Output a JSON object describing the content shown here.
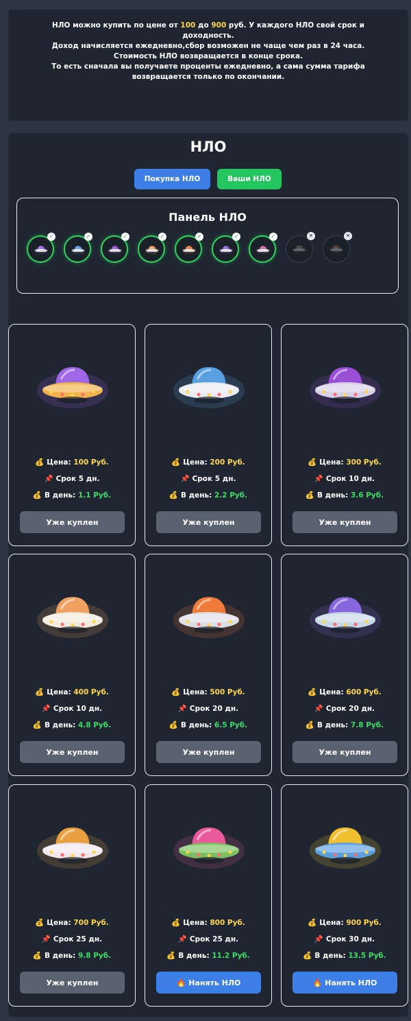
{
  "info": {
    "line1_pre": "НЛО можно купить по цене от ",
    "line1_min": "100",
    "line1_mid": " до ",
    "line1_max": "900",
    "line1_post": " руб. У каждого НЛО свой срок и",
    "line2": "доходность.",
    "line3": "Доход начисляется ежедневно,сбор возможен не чаще чем раз в 24 часа.",
    "line4": "Стоимость НЛО возвращается в конце срока.",
    "line5": "То есть сначала вы получаете проценты ежедневно, а сама сумма тарифа",
    "line6": "возвращается только по окончании."
  },
  "page_title": "НЛО",
  "tabs": {
    "buy": "Покупка НЛО",
    "mine": "Ваши НЛО"
  },
  "panel": {
    "title": "Панель НЛО",
    "slots": [
      {
        "state": "owned",
        "color": "#a066e8"
      },
      {
        "state": "owned",
        "color": "#5aa0e0"
      },
      {
        "state": "owned",
        "color": "#9a4fd6"
      },
      {
        "state": "owned",
        "color": "#f0a060"
      },
      {
        "state": "owned",
        "color": "#f07a3a"
      },
      {
        "state": "owned",
        "color": "#8866dd"
      },
      {
        "state": "owned",
        "color": "#cc66aa"
      },
      {
        "state": "locked",
        "color": "#8a8f60"
      },
      {
        "state": "locked",
        "color": "#b08040"
      }
    ]
  },
  "labels": {
    "price": "Цена:",
    "term": "Срок",
    "daily": "В день:",
    "owned_btn": "Уже куплен",
    "hire_btn": "Нанять НЛО"
  },
  "colors": {
    "accent_blue": "#3d7fe6",
    "accent_green": "#22c55e",
    "price_yellow": "#ffd54a",
    "daily_green": "#3ddc68"
  },
  "cards": [
    {
      "price": "100 Руб.",
      "term": "5 дн.",
      "daily": "1.1 Руб.",
      "status": "owned",
      "dome": "#a066e8",
      "body": "#f0b24a"
    },
    {
      "price": "200 Руб.",
      "term": "5 дн.",
      "daily": "2.2 Руб.",
      "status": "owned",
      "dome": "#5aa0e0",
      "body": "#e8ebf0"
    },
    {
      "price": "300 Руб.",
      "term": "10 дн.",
      "daily": "3.6 Руб.",
      "status": "owned",
      "dome": "#9a4fd6",
      "body": "#d8d0e8"
    },
    {
      "price": "400 Руб.",
      "term": "10 дн.",
      "daily": "4.8 Руб.",
      "status": "owned",
      "dome": "#f0a060",
      "body": "#f2eadc"
    },
    {
      "price": "500 Руб.",
      "term": "20 дн.",
      "daily": "6.5 Руб.",
      "status": "owned",
      "dome": "#f07a3a",
      "body": "#dcdfe6"
    },
    {
      "price": "600 Руб.",
      "term": "20 дн.",
      "daily": "7.8 Руб.",
      "status": "owned",
      "dome": "#8866dd",
      "body": "#c8d8e8"
    },
    {
      "price": "700 Руб.",
      "term": "25 дн.",
      "daily": "9.8 Руб.",
      "status": "owned",
      "dome": "#e8a040",
      "body": "#f0e6ee"
    },
    {
      "price": "800 Руб.",
      "term": "25 дн.",
      "daily": "11.2 Руб.",
      "status": "hire",
      "dome": "#e85a9a",
      "body": "#7ac060"
    },
    {
      "price": "900 Руб.",
      "term": "30 дн.",
      "daily": "13.5 Руб.",
      "status": "hire",
      "dome": "#f0c030",
      "body": "#5aa0e0"
    }
  ]
}
